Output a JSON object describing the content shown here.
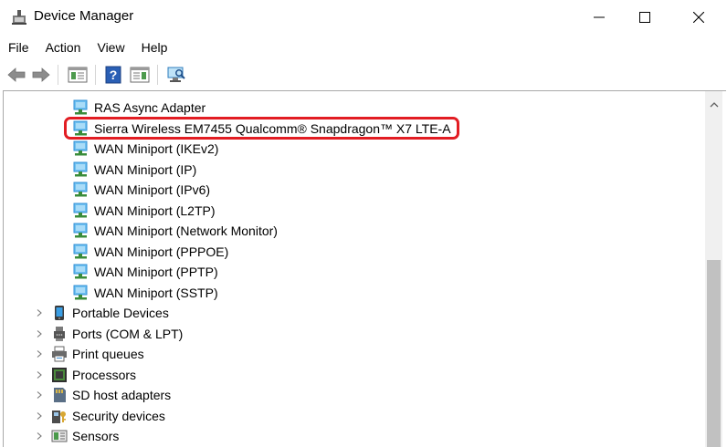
{
  "window": {
    "title": "Device Manager",
    "controls": [
      "minimize",
      "maximize",
      "close"
    ]
  },
  "menu": [
    "File",
    "Action",
    "View",
    "Help"
  ],
  "toolbar": {
    "buttons": [
      "back-arrow-icon",
      "forward-arrow-icon",
      "properties-icon",
      "help-icon",
      "update-driver-icon",
      "scan-hardware-icon"
    ]
  },
  "tree": {
    "network_adapters": [
      "RAS Async Adapter",
      "Sierra Wireless EM7455 Qualcomm® Snapdragon™ X7 LTE-A",
      "WAN Miniport (IKEv2)",
      "WAN Miniport (IP)",
      "WAN Miniport (IPv6)",
      "WAN Miniport (L2TP)",
      "WAN Miniport (Network Monitor)",
      "WAN Miniport (PPPOE)",
      "WAN Miniport (PPTP)",
      "WAN Miniport (SSTP)"
    ],
    "categories": [
      "Portable Devices",
      "Ports (COM & LPT)",
      "Print queues",
      "Processors",
      "SD host adapters",
      "Security devices",
      "Sensors"
    ]
  },
  "annotation": {
    "highlight_color": "#e21d23",
    "highlighted_item": "Sierra Wireless EM7455 Qualcomm® Snapdragon™ X7 LTE-A"
  },
  "colors": {
    "network_icon": "#2f8fd6",
    "scroll_thumb": "#c1c1c1"
  }
}
